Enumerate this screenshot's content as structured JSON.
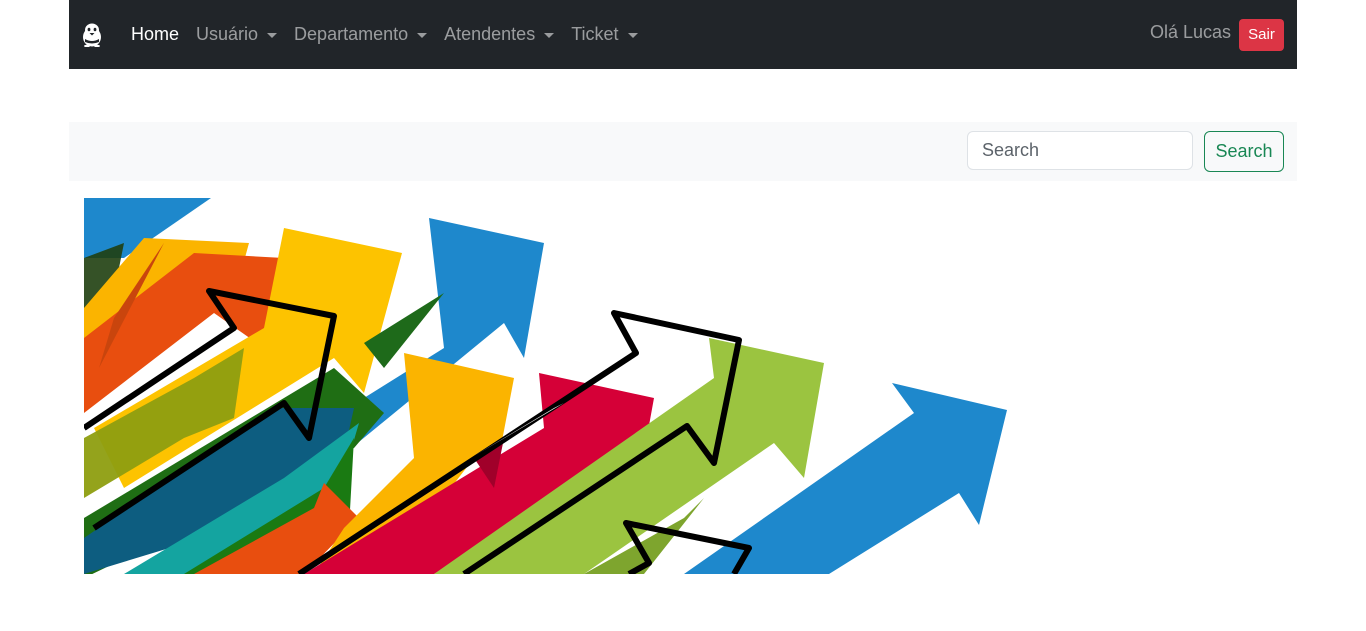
{
  "navbar": {
    "logo_icon": "penguin-icon",
    "links": [
      {
        "label": "Home",
        "active": true,
        "dropdown": false
      },
      {
        "label": "Usuário",
        "active": false,
        "dropdown": true
      },
      {
        "label": "Departamento",
        "active": false,
        "dropdown": true
      },
      {
        "label": "Atendentes",
        "active": false,
        "dropdown": true
      },
      {
        "label": "Ticket",
        "active": false,
        "dropdown": true
      }
    ],
    "greeting": "Olá Lucas",
    "logout_label": "Sair"
  },
  "search": {
    "placeholder": "Search",
    "value": "",
    "button_label": "Search"
  },
  "hero": {
    "image_icon": "growth-arrows-illustration"
  },
  "colors": {
    "navbar_bg": "#212529",
    "danger": "#dc3545",
    "success": "#198754",
    "arrow_blue": "#1e88cc",
    "arrow_yellow": "#fbb400",
    "arrow_orange": "#e84e0f",
    "arrow_red": "#d50037",
    "arrow_green": "#9bc440"
  }
}
